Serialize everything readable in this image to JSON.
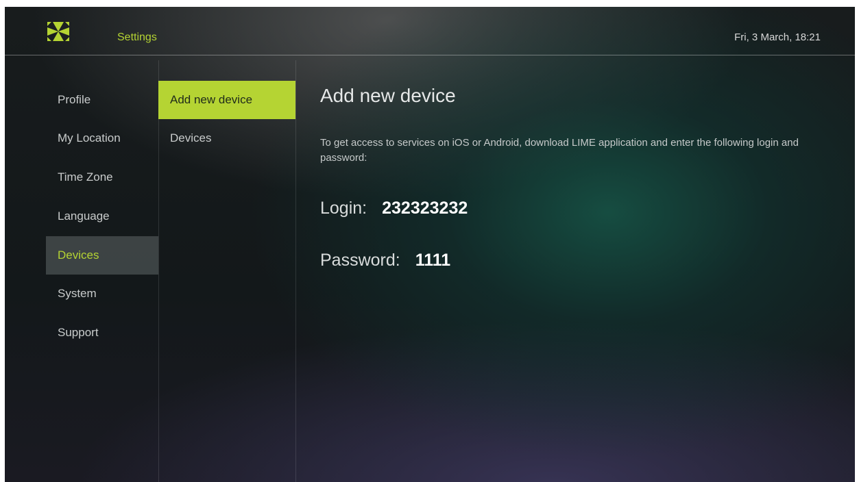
{
  "header": {
    "title": "Settings",
    "datetime": "Fri, 3 March, 18:21",
    "logo_icon": "lime-logo-icon",
    "accent_color": "#b5d433"
  },
  "sidebar": {
    "items": [
      {
        "label": "Profile",
        "active": false
      },
      {
        "label": "My Location",
        "active": false
      },
      {
        "label": "Time Zone",
        "active": false
      },
      {
        "label": "Language",
        "active": false
      },
      {
        "label": "Devices",
        "active": true
      },
      {
        "label": "System",
        "active": false
      },
      {
        "label": "Support",
        "active": false
      }
    ]
  },
  "submenu": {
    "items": [
      {
        "label": "Add new device",
        "active": true
      },
      {
        "label": "Devices",
        "active": false
      }
    ]
  },
  "content": {
    "title": "Add new device",
    "description": "To get access to services on iOS or Android, download LIME application and enter the following login and password:",
    "login_label": "Login:",
    "login_value": "232323232",
    "password_label": "Password:",
    "password_value": "1111"
  }
}
